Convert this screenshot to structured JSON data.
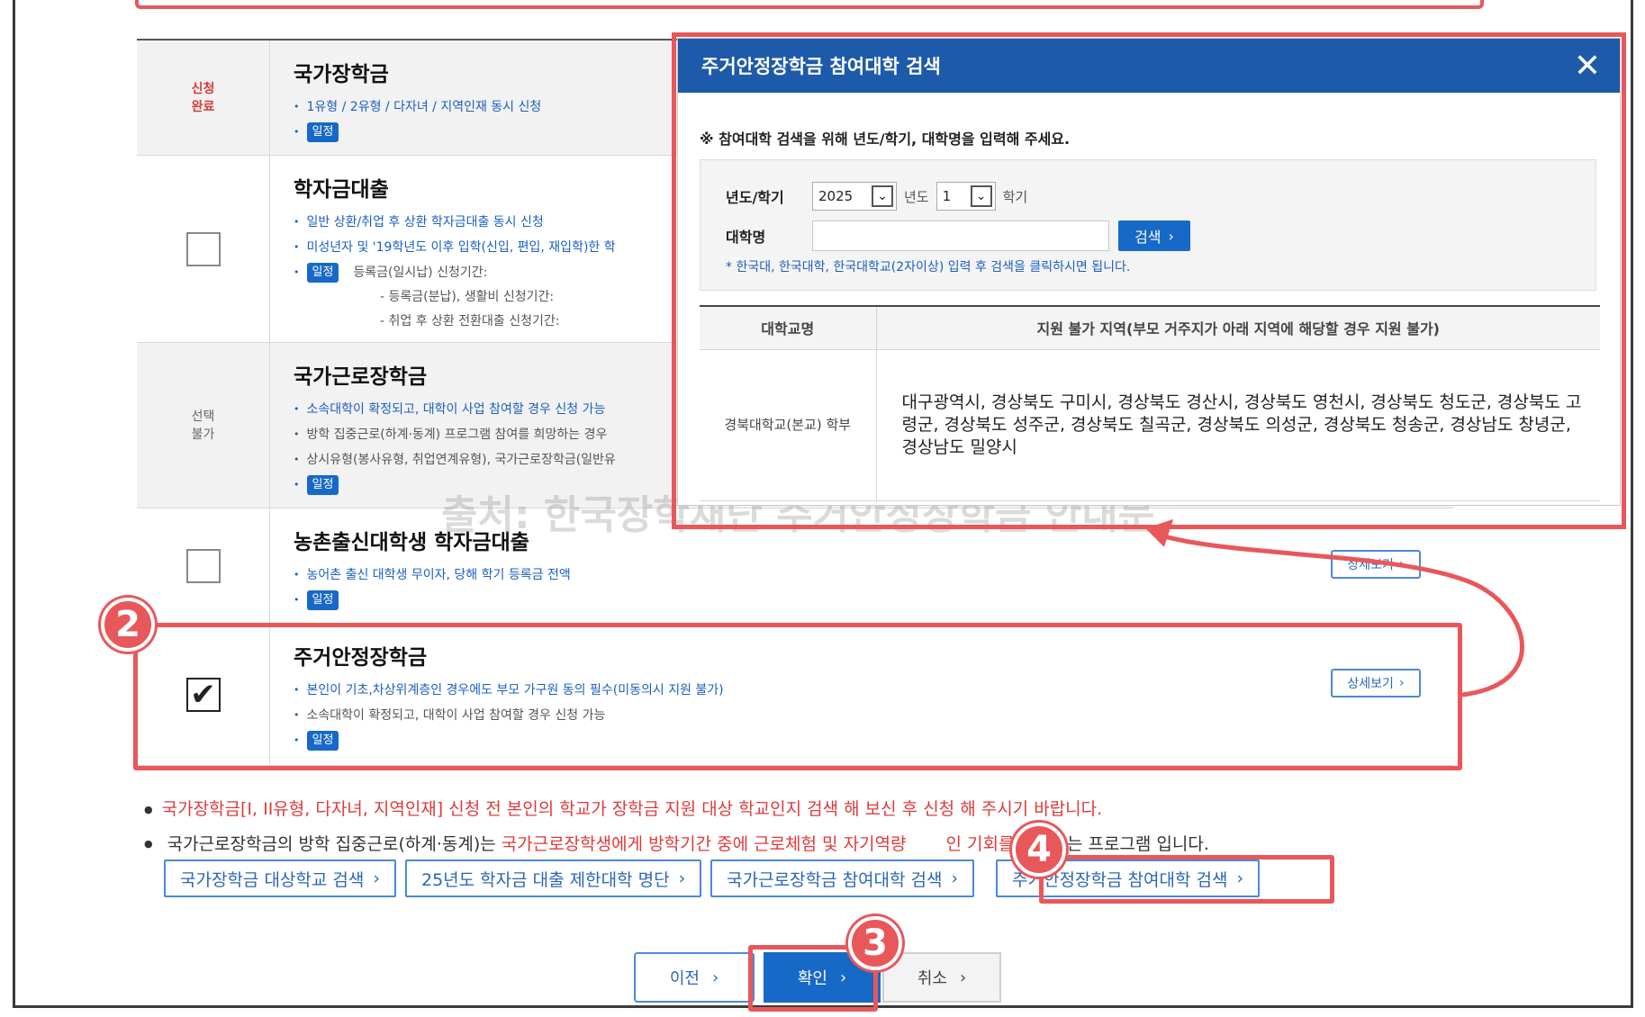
{
  "rows": [
    {
      "status": "신청\n완료",
      "title": "국가장학금",
      "bullets": [
        "1유형 / 2유형 / 다자녀 / 지역인재 동시 신청"
      ],
      "schedule_label": "일정"
    },
    {
      "title": "학자금대출",
      "bullets": [
        "일반 상환/취업 후 상환 학자금대출 동시 신청",
        "미성년자 및 '19학년도 이후 입학(신입, 편입, 재입학)한 학"
      ],
      "schedule_label": "일정",
      "schedule_lines": [
        "등록금(일시납) 신청기간:",
        "- 등록금(분납), 생활비 신청기간:",
        "- 취업 후 상환 전환대출 신청기간:"
      ]
    },
    {
      "status": "선택\n불가",
      "title": "국가근로장학금",
      "bullets": [
        "소속대학이 확정되고, 대학이 사업 참여할 경우 신청 가능",
        "방학 집중근로(하계·동계) 프로그램 참여를 희망하는 경우",
        "상시유형(봉사유형, 취업연계유형), 국가근로장학금(일반유"
      ],
      "schedule_label": "일정"
    },
    {
      "title": "농촌출신대학생 학자금대출",
      "bullets": [
        "농어촌 출신 대학생 무이자, 당해 학기 등록금 전액"
      ],
      "schedule_label": "일정",
      "detail_label": "상세보기"
    },
    {
      "title": "주거안정장학금",
      "bullets": [
        "본인이 기초,차상위계층인 경우에도 부모 가구원 동의 필수(미동의시 지원 불가)",
        "소속대학이 확정되고, 대학이 사업 참여할 경우 신청 가능"
      ],
      "schedule_label": "일정",
      "detail_label": "상세보기",
      "checked_mark": "✔"
    }
  ],
  "notes": {
    "note1": "국가장학금[I, II유형, 다자녀, 지역인재] 신청 전 본인의 학교가 장학금 지원 대상 학교인지 검색 해 보신 후 신청 해 주시기 바랍니다.",
    "note2_a": "국가근로장학금의 방학 집중근로(하계·동계)는 ",
    "note2_b": "국가근로장학생에게 방학기간 중에 근로체험 및 자기역량",
    "note2_c": "  ",
    "note2_d": "인 기회를 제공",
    "note2_e": "하는 프로그램 입니다."
  },
  "search_links": [
    "국가장학금 대상학교 검색",
    "25년도 학자금 대출 제한대학 명단",
    "국가근로장학금 참여대학 검색",
    "주거안정장학금 참여대학 검색"
  ],
  "bottom_buttons": {
    "prev": "이전",
    "ok": "확인",
    "cancel": "취소"
  },
  "watermark": "출처: 한국장학재단 주거안정장학금 안내문",
  "steps": [
    "2",
    "3",
    "4"
  ],
  "modal": {
    "title": "주거안정장학금 참여대학 검색",
    "instruction": "※ 참여대학 검색을 위해 년도/학기, 대학명을 입력해 주세요.",
    "year_label": "년도/학기",
    "year_value": "2025",
    "year_unit": "년도",
    "semester_value": "1",
    "semester_unit": "학기",
    "univ_label": "대학명",
    "univ_value": "",
    "search_button": "검색",
    "hint": "* 한국대, 한국대학, 한국대학교(2자이상) 입력 후 검색을 클릭하시면 됩니다.",
    "table": {
      "headers": [
        "대학교명",
        "지원 불가 지역(부모 거주지가 아래 지역에 해당할 경우 지원 불가)"
      ],
      "rows": [
        {
          "university": "경북대학교(본교) 학부",
          "regions": "대구광역시, 경상북도 구미시, 경상북도 경산시, 경상북도 영천시, 경상북도 청도군, 경상북도 고령군, 경상북도 성주군, 경상북도 칠곡군, 경상북도 의성군, 경상북도 청송군, 경상남도 창녕군, 경상남도 밀양시"
        }
      ]
    }
  },
  "colors": {
    "accent": "#1769c8",
    "highlight": "#e8575a",
    "header": "#1e5aaa"
  }
}
